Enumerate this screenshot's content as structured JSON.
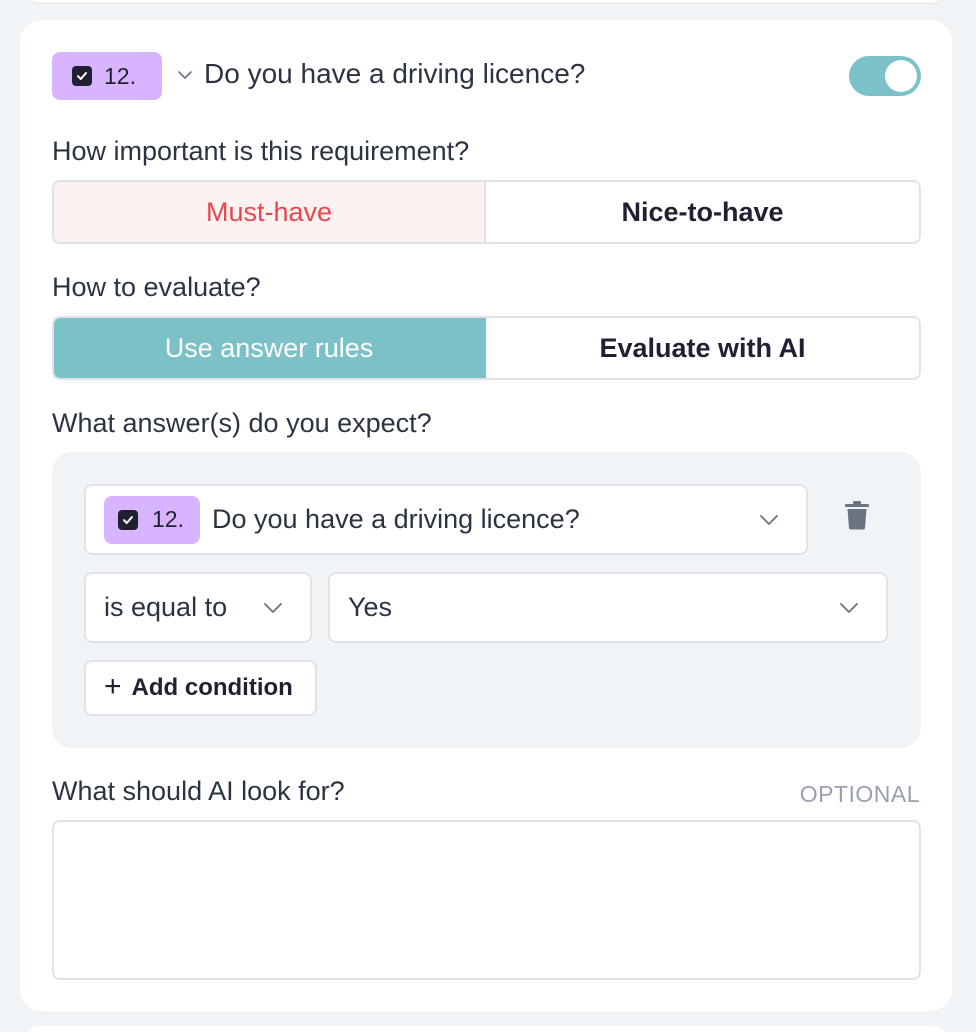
{
  "question": {
    "number": "12.",
    "title": "Do you have a driving licence?",
    "enabled": true,
    "icons": {
      "type": "checkbox-icon",
      "collapse": "chevron-down-icon"
    }
  },
  "importance": {
    "label": "How important is this requirement?",
    "options": [
      "Must-have",
      "Nice-to-have"
    ],
    "selected": "Must-have"
  },
  "evaluation": {
    "label": "How to evaluate?",
    "options": [
      "Use answer rules",
      "Evaluate with AI"
    ],
    "selected": "Use answer rules"
  },
  "answers": {
    "label": "What answer(s) do you expect?",
    "rule": {
      "question_number": "12.",
      "question_title": "Do you have a driving licence?",
      "operator": "is equal to",
      "value": "Yes"
    },
    "add_condition_label": "Add condition"
  },
  "ai_lookfor": {
    "label": "What should AI look for?",
    "optional_tag": "OPTIONAL",
    "value": ""
  },
  "colors": {
    "accent": "#7cc0c8",
    "badge": "#d8b4fe",
    "must_have_text": "#e5484d",
    "must_have_bg": "#fef1f1"
  }
}
